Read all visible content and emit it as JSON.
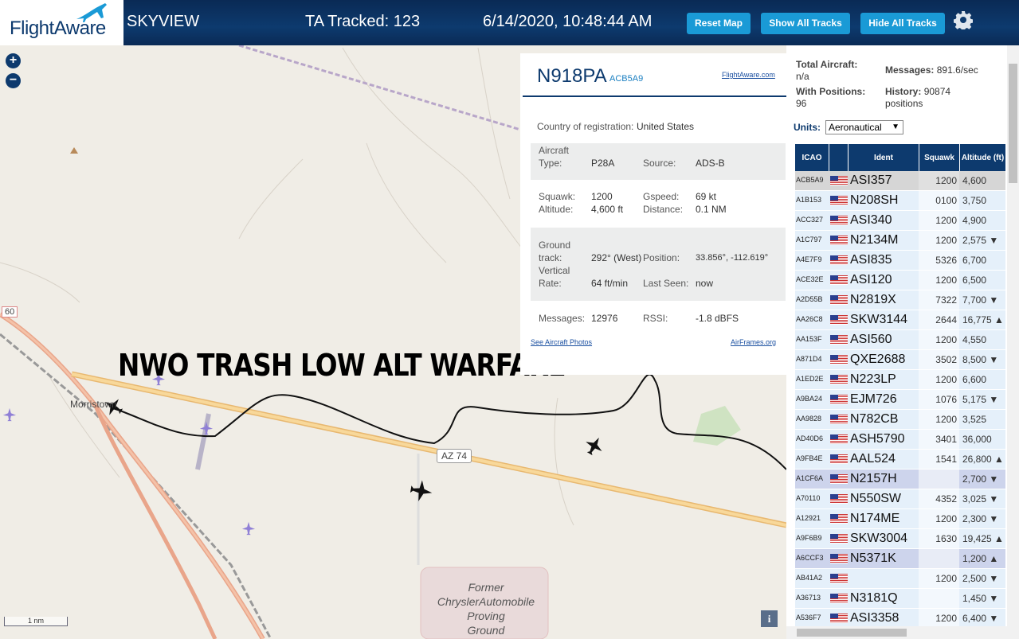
{
  "header": {
    "logo_text": "FlightAware",
    "app_name": "SKYVIEW",
    "tracked": "TA Tracked: 123",
    "datetime": "6/14/2020, 10:48:44 AM",
    "buttons": {
      "reset": "Reset Map",
      "show": "Show All Tracks",
      "hide": "Hide All Tracks"
    }
  },
  "map": {
    "zoom_in": "+",
    "zoom_out": "−",
    "overlay_text": "NWO TRASH LOW ALT WARFARE",
    "town_label": "Morristown",
    "road_label": "AZ 74",
    "road_60": "60",
    "former_label": "Former Chrysler Automobile Proving Ground",
    "former_lines": [
      "Former",
      "ChryslerAutomobile",
      "Proving",
      "Ground"
    ],
    "scale": "1 nm",
    "info": "i"
  },
  "popup": {
    "callsign": "N918PA",
    "hex": "ACB5A9",
    "link": "FlightAware.com",
    "country_label": "Country of registration:",
    "country": "United States",
    "aircraft_type_label": "Aircraft Type:",
    "aircraft_type": "P28A",
    "source_label": "Source:",
    "source": "ADS-B",
    "squawk_label": "Squawk:",
    "squawk": "1200",
    "altitude_label": "Altitude:",
    "altitude": "4,600 ft",
    "gspeed_label": "Gspeed:",
    "gspeed": "69 kt",
    "distance_label": "Distance:",
    "distance": "0.1 NM",
    "ground_track_label": "Ground track:",
    "ground_track": "292° (West)",
    "position_label": "Position:",
    "position": "33.856°, -112.619°",
    "vrate_label": "Vertical Rate:",
    "vrate": "64 ft/min",
    "last_seen_label": "Last Seen:",
    "last_seen": "now",
    "messages_label": "Messages:",
    "messages": "12976",
    "rssi_label": "RSSI:",
    "rssi": "-1.8 dBFS",
    "photos": "See Aircraft Photos",
    "airframes": "AirFrames.org"
  },
  "panel": {
    "total_label": "Total Aircraft:",
    "total": "n/a",
    "messages_label": "Messages:",
    "messages": "891.6/sec",
    "with_pos_label": "With Positions:",
    "with_pos": "96",
    "history_label": "History:",
    "history": "90874",
    "history_unit": "positions",
    "units_label": "Units:",
    "units": "Aeronautical",
    "columns": [
      "ICAO",
      "",
      "Ident",
      "Squawk",
      "Altitude (ft)"
    ],
    "rows": [
      {
        "icao": "ACB5A9",
        "ident": "ASI357",
        "squawk": "1200",
        "alt": "4,600",
        "sel": true
      },
      {
        "icao": "A1B153",
        "ident": "N208SH",
        "squawk": "0100",
        "alt": "3,750"
      },
      {
        "icao": "ACC327",
        "ident": "ASI340",
        "squawk": "1200",
        "alt": "4,900"
      },
      {
        "icao": "A1C797",
        "ident": "N2134M",
        "squawk": "1200",
        "alt": "2,575 ▼"
      },
      {
        "icao": "A4E7F9",
        "ident": "ASI835",
        "squawk": "5326",
        "alt": "6,700"
      },
      {
        "icao": "ACE32E",
        "ident": "ASI120",
        "squawk": "1200",
        "alt": "6,500"
      },
      {
        "icao": "A2D55B",
        "ident": "N2819X",
        "squawk": "7322",
        "alt": "7,700 ▼"
      },
      {
        "icao": "AA26C8",
        "ident": "SKW3144",
        "squawk": "2644",
        "alt": "16,775 ▲"
      },
      {
        "icao": "AA153F",
        "ident": "ASI560",
        "squawk": "1200",
        "alt": "4,550"
      },
      {
        "icao": "A871D4",
        "ident": "QXE2688",
        "squawk": "3502",
        "alt": "8,500 ▼"
      },
      {
        "icao": "A1ED2E",
        "ident": "N223LP",
        "squawk": "1200",
        "alt": "6,600"
      },
      {
        "icao": "A9BA24",
        "ident": "EJM726",
        "squawk": "1076",
        "alt": "5,175 ▼"
      },
      {
        "icao": "AA9828",
        "ident": "N782CB",
        "squawk": "1200",
        "alt": "3,525"
      },
      {
        "icao": "AD40D6",
        "ident": "ASH5790",
        "squawk": "3401",
        "alt": "36,000"
      },
      {
        "icao": "A9FB4E",
        "ident": "AAL524",
        "squawk": "1541",
        "alt": "26,800 ▲"
      },
      {
        "icao": "A1CF6A",
        "ident": "N2157H",
        "squawk": "",
        "alt": "2,700 ▼",
        "noalt": true
      },
      {
        "icao": "A70110",
        "ident": "N550SW",
        "squawk": "4352",
        "alt": "3,025 ▼"
      },
      {
        "icao": "A12921",
        "ident": "N174ME",
        "squawk": "1200",
        "alt": "2,300 ▼"
      },
      {
        "icao": "A9F6B9",
        "ident": "SKW3004",
        "squawk": "1630",
        "alt": "19,425 ▲"
      },
      {
        "icao": "A6CCF3",
        "ident": "N5371K",
        "squawk": "",
        "alt": "1,200 ▲",
        "noalt": true
      },
      {
        "icao": "AB41A2",
        "ident": "",
        "squawk": "1200",
        "alt": "2,500 ▼"
      },
      {
        "icao": "A36713",
        "ident": "N3181Q",
        "squawk": "",
        "alt": "1,450 ▼"
      },
      {
        "icao": "A536F7",
        "ident": "ASI3358",
        "squawk": "1200",
        "alt": "6,400 ▼"
      }
    ]
  }
}
